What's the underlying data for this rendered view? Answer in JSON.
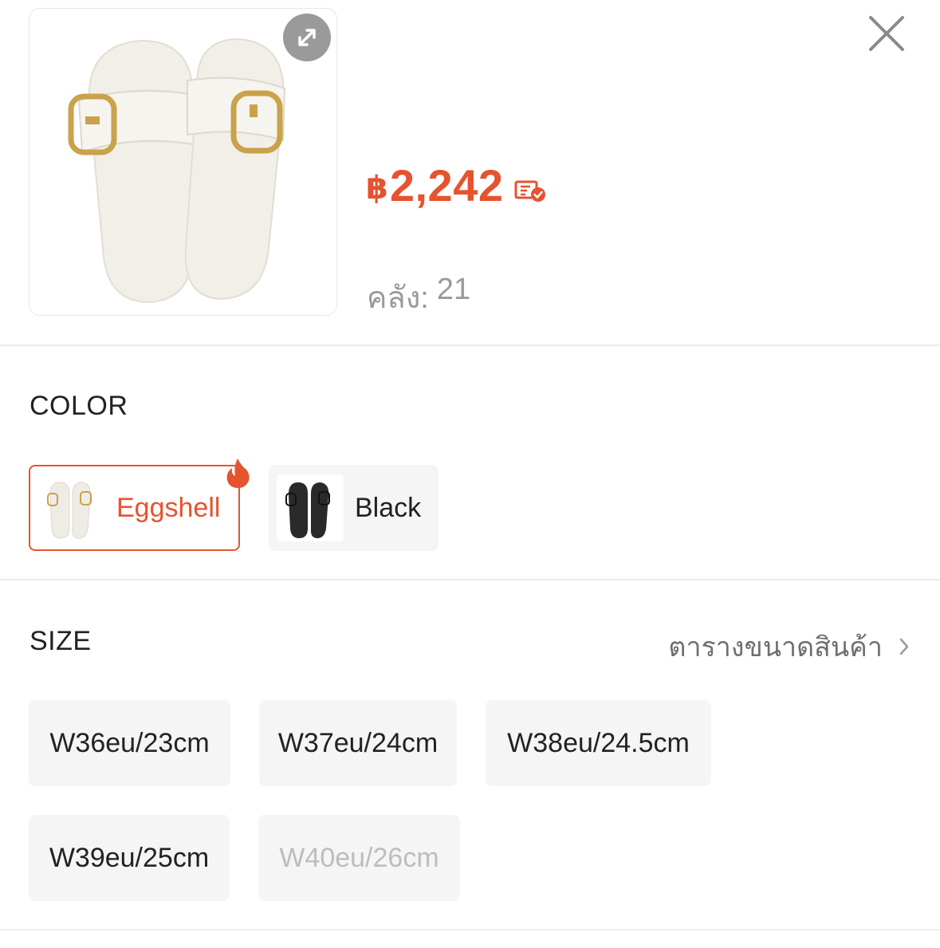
{
  "product": {
    "price_currency": "฿",
    "price": "2,242",
    "stock_label": "คลัง:",
    "stock_value": "21"
  },
  "colors": {
    "accent": "#e5532f",
    "chip_bg": "#f5f5f5",
    "divider": "#ededed"
  },
  "icons": {
    "expand": "expand-icon",
    "close": "close-icon",
    "voucher": "voucher-icon",
    "flame": "flame-icon",
    "chevron": "chevron-right-icon"
  },
  "color_section": {
    "title": "COLOR",
    "options": [
      {
        "label": "Eggshell",
        "selected": true,
        "hot": true
      },
      {
        "label": "Black",
        "selected": false,
        "hot": false
      }
    ]
  },
  "size_section": {
    "title": "SIZE",
    "chart_link": "ตารางขนาดสินค้า",
    "options": [
      {
        "label": "W36eu/23cm",
        "available": true
      },
      {
        "label": "W37eu/24cm",
        "available": true
      },
      {
        "label": "W38eu/24.5cm",
        "available": true
      },
      {
        "label": "W39eu/25cm",
        "available": true
      },
      {
        "label": "W40eu/26cm",
        "available": false
      }
    ]
  }
}
